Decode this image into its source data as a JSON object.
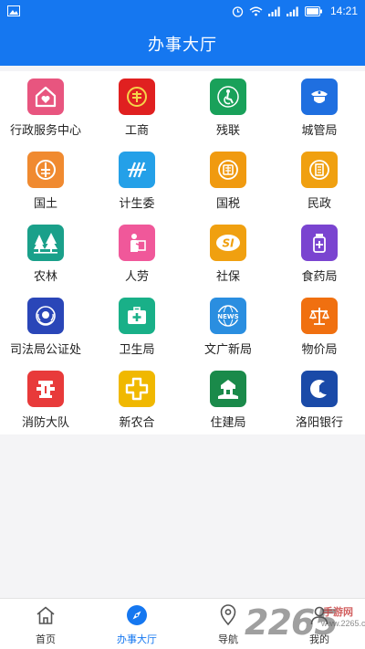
{
  "status_bar": {
    "time": "14:21",
    "icons": [
      "image-icon",
      "alarm-icon",
      "wifi-icon",
      "signal-icon",
      "signal-icon",
      "battery-icon"
    ]
  },
  "header": {
    "title": "办事大厅"
  },
  "grid": [
    {
      "label": "行政服务中心",
      "color": "#e8557f",
      "icon": "house-heart-icon"
    },
    {
      "label": "工商",
      "color": "#e02020",
      "icon": "emblem-icon"
    },
    {
      "label": "残联",
      "color": "#19a15a",
      "icon": "disability-icon"
    },
    {
      "label": "城管局",
      "color": "#1f6fe0",
      "icon": "badge-icon"
    },
    {
      "label": "国土",
      "color": "#f08a30",
      "icon": "land-icon"
    },
    {
      "label": "计生委",
      "color": "#24a0e8",
      "icon": "family-icon"
    },
    {
      "label": "国税",
      "color": "#f09a10",
      "icon": "tax-icon"
    },
    {
      "label": "民政",
      "color": "#f0a010",
      "icon": "civil-icon"
    },
    {
      "label": "农林",
      "color": "#1aa08a",
      "icon": "trees-icon"
    },
    {
      "label": "人劳",
      "color": "#f0589a",
      "icon": "worker-icon"
    },
    {
      "label": "社保",
      "color": "#f0a010",
      "icon": "social-security-icon"
    },
    {
      "label": "食药局",
      "color": "#7a44d0",
      "icon": "medicine-icon"
    },
    {
      "label": "司法局公证处",
      "color": "#2a46b8",
      "icon": "justice-icon"
    },
    {
      "label": "卫生局",
      "color": "#19b088",
      "icon": "medkit-icon"
    },
    {
      "label": "文广新局",
      "color": "#2a8ee0",
      "icon": "news-icon"
    },
    {
      "label": "物价局",
      "color": "#f07010",
      "icon": "scales-icon"
    },
    {
      "label": "消防大队",
      "color": "#e83a3a",
      "icon": "fire-hydrant-icon"
    },
    {
      "label": "新农合",
      "color": "#f0b800",
      "icon": "cross-icon"
    },
    {
      "label": "住建局",
      "color": "#1a8a4a",
      "icon": "building-icon"
    },
    {
      "label": "洛阳银行",
      "color": "#1a4aa8",
      "icon": "bank-icon"
    }
  ],
  "bottom_nav": [
    {
      "label": "首页",
      "icon": "home-icon",
      "active": false
    },
    {
      "label": "办事大厅",
      "icon": "compass-icon",
      "active": true
    },
    {
      "label": "导航",
      "icon": "map-pin-icon",
      "active": false
    },
    {
      "label": "我的",
      "icon": "user-icon",
      "active": false
    }
  ],
  "watermark": {
    "number": "2265",
    "sub": "手游网",
    "url": "www.2265.com"
  },
  "colors": {
    "primary": "#1577f0",
    "background": "#f4f4f6",
    "panel": "#ffffff"
  }
}
